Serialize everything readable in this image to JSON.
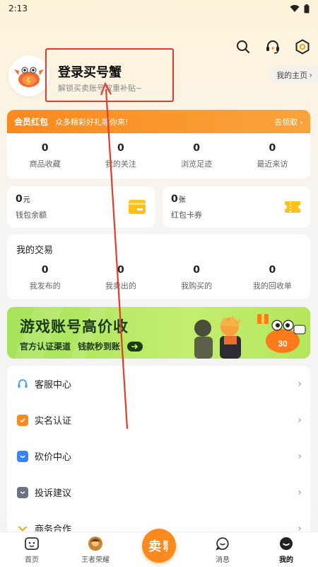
{
  "status": {
    "time": "2:13"
  },
  "profile": {
    "title": "登录买号蟹",
    "subtitle": "解锁买卖账号双重补贴~",
    "homepage": "我的主页"
  },
  "member": {
    "tag": "会员红包",
    "promo": "众多精彩好礼等你来!",
    "get": "去领取"
  },
  "stats": [
    {
      "num": "0",
      "label": "商品收藏"
    },
    {
      "num": "0",
      "label": "我的关注"
    },
    {
      "num": "0",
      "label": "浏览足迹"
    },
    {
      "num": "0",
      "label": "最近来访"
    }
  ],
  "wallet": {
    "value": "0",
    "unit": "元",
    "label": "钱包余额"
  },
  "coupon": {
    "value": "0",
    "unit": "张",
    "label": "红包卡券"
  },
  "trade": {
    "title": "我的交易",
    "items": [
      {
        "num": "0",
        "label": "我发布的"
      },
      {
        "num": "0",
        "label": "我卖出的"
      },
      {
        "num": "0",
        "label": "我购买的"
      },
      {
        "num": "0",
        "label": "我的回收单"
      }
    ]
  },
  "banner": {
    "big": "游戏账号高价收",
    "left": "官方认证渠道",
    "right": "钱款秒到账",
    "badge": "30"
  },
  "menu": [
    {
      "label": "客服中心",
      "icon": "headset-icon",
      "color": "#3aa0f0"
    },
    {
      "label": "实名认证",
      "icon": "id-badge-icon",
      "color": "#fb8a1e"
    },
    {
      "label": "砍价中心",
      "icon": "bargain-icon",
      "color": "#3b82f6"
    },
    {
      "label": "投诉建议",
      "icon": "complaint-icon",
      "color": "#6b7280"
    },
    {
      "label": "商务合作",
      "icon": "handshake-icon",
      "color": "#f5a623"
    }
  ],
  "nav": [
    {
      "label": "首页",
      "icon": "home-icon"
    },
    {
      "label": "王者荣耀",
      "icon": "game-avatar-icon"
    },
    {
      "label": "消息",
      "icon": "message-icon"
    },
    {
      "label": "我的",
      "icon": "profile-icon"
    }
  ],
  "sell": {
    "big": "卖",
    "small": "账号"
  },
  "colors": {
    "accent": "#fb8a1e",
    "annotation": "#e33b2f"
  }
}
